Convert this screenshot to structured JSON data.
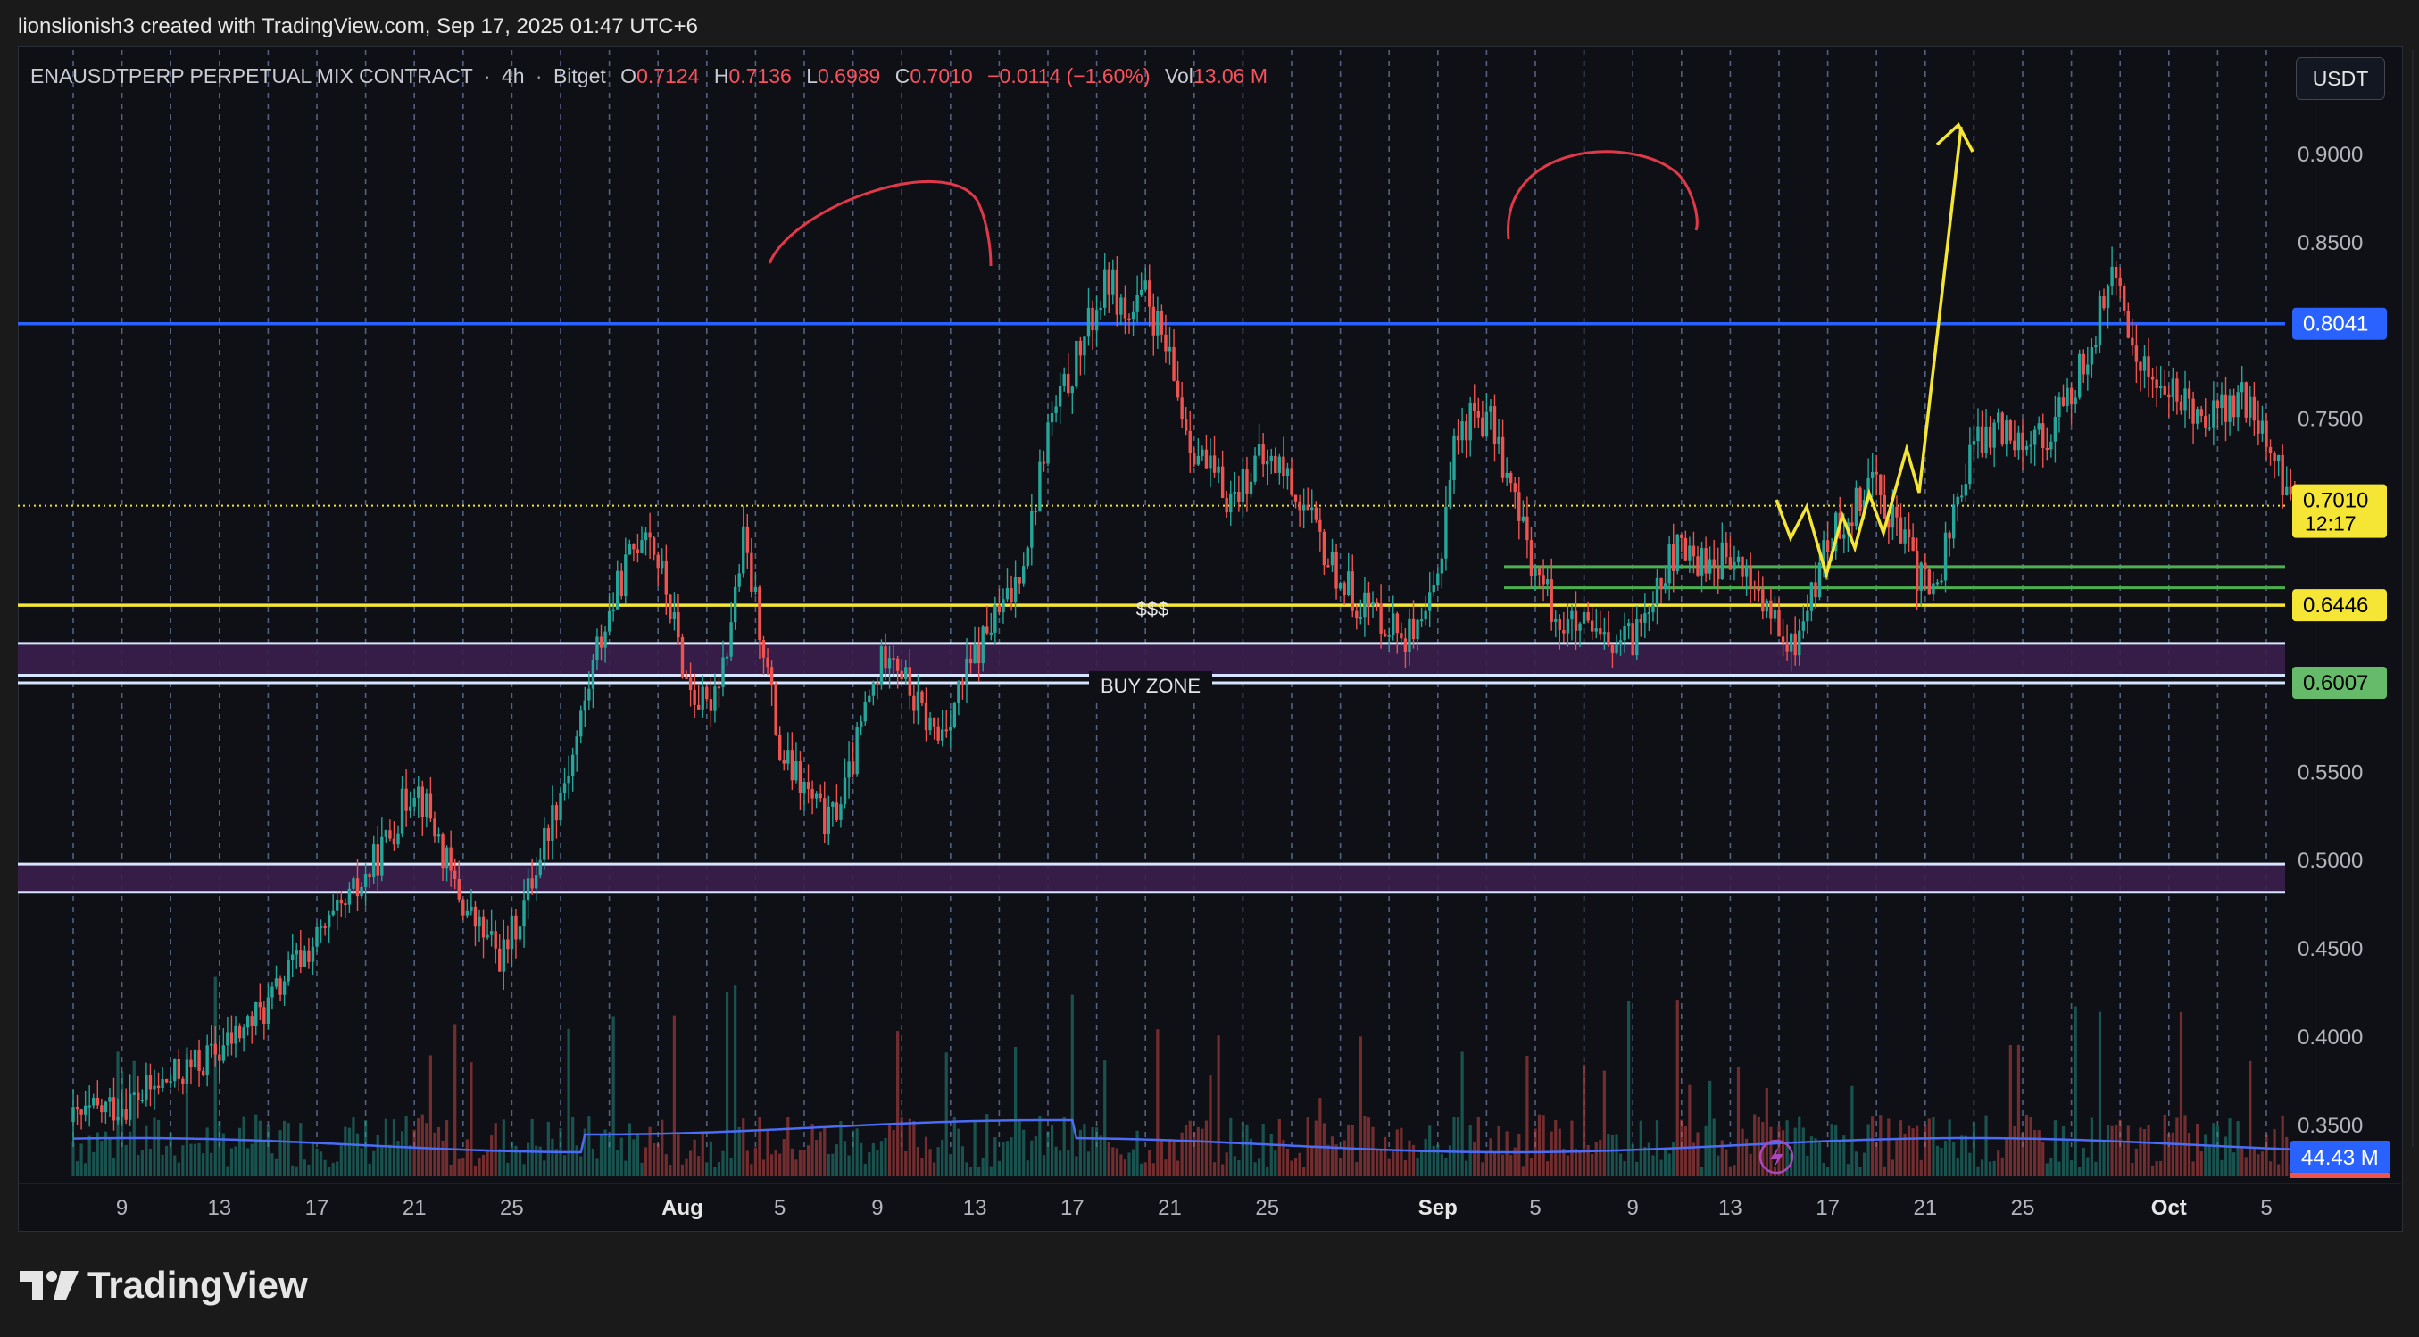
{
  "attribution": "lionslionish3 created with TradingView.com, Sep 17, 2025 01:47 UTC+6",
  "legend": {
    "symbol": "ENAUSDTPERP PERPETUAL MIX CONTRACT",
    "interval": "4h",
    "exchange": "Bitget",
    "o_label": "O",
    "o": "0.7124",
    "h_label": "H",
    "h": "0.7136",
    "l_label": "L",
    "l": "0.6989",
    "c_label": "C",
    "c": "0.7010",
    "change": "−0.0114 (−1.60%)",
    "vol_label": "Vol",
    "vol": "13.06 M"
  },
  "currency_button": "USDT",
  "brand": "TradingView",
  "colors": {
    "background": "#0f1015",
    "up_candle": "#26a69a",
    "down_candle": "#ef5350",
    "resistance_line": "#2962ff",
    "support_line": "#f5e635",
    "zone_fill": "#3a1f4d",
    "zone_border": "#d6e4ff",
    "green_line": "#4caf50",
    "projection": "#f5e635",
    "arc": "#e0394a",
    "volume_ma": "#4a6cf7",
    "grid_dashed": "#8aa4d6"
  },
  "chart_data": {
    "type": "candlestick",
    "title": "ENAUSDTPERP PERPETUAL MIX CONTRACT",
    "ylim": [
      0.33,
      0.92
    ],
    "y_ticks": [
      "0.9000",
      "0.8500",
      "0.7500",
      "0.5500",
      "0.5000",
      "0.4500",
      "0.4000",
      "0.3500"
    ],
    "x_ticks": [
      "9",
      "13",
      "17",
      "21",
      "25",
      "Aug",
      "5",
      "9",
      "13",
      "17",
      "21",
      "25",
      "Sep",
      "5",
      "9",
      "13",
      "17",
      "21",
      "25",
      "Oct",
      "5"
    ],
    "x_tick_days": [
      9,
      13,
      17,
      21,
      25,
      32,
      36,
      40,
      44,
      48,
      52,
      56,
      63,
      67,
      71,
      75,
      79,
      83,
      87,
      93,
      97
    ],
    "price_path": [
      [
        7.0,
        0.352
      ],
      [
        8.0,
        0.358
      ],
      [
        9.5,
        0.365
      ],
      [
        10.5,
        0.372
      ],
      [
        12.0,
        0.384
      ],
      [
        13.0,
        0.392
      ],
      [
        14.0,
        0.405
      ],
      [
        15.0,
        0.418
      ],
      [
        16.0,
        0.44
      ],
      [
        17.0,
        0.455
      ],
      [
        18.0,
        0.47
      ],
      [
        19.0,
        0.49
      ],
      [
        20.0,
        0.515
      ],
      [
        21.0,
        0.545
      ],
      [
        21.8,
        0.52
      ],
      [
        22.5,
        0.49
      ],
      [
        23.2,
        0.47
      ],
      [
        24.0,
        0.455
      ],
      [
        24.6,
        0.445
      ],
      [
        25.5,
        0.475
      ],
      [
        26.5,
        0.52
      ],
      [
        27.5,
        0.56
      ],
      [
        28.5,
        0.62
      ],
      [
        29.5,
        0.66
      ],
      [
        30.5,
        0.693
      ],
      [
        31.3,
        0.655
      ],
      [
        32.2,
        0.6
      ],
      [
        33.0,
        0.585
      ],
      [
        33.8,
        0.62
      ],
      [
        34.5,
        0.68
      ],
      [
        35.3,
        0.625
      ],
      [
        36.0,
        0.56
      ],
      [
        37.0,
        0.54
      ],
      [
        38.0,
        0.52
      ],
      [
        38.8,
        0.545
      ],
      [
        39.5,
        0.585
      ],
      [
        40.5,
        0.625
      ],
      [
        41.5,
        0.59
      ],
      [
        42.5,
        0.57
      ],
      [
        43.5,
        0.6
      ],
      [
        44.5,
        0.63
      ],
      [
        45.5,
        0.65
      ],
      [
        46.3,
        0.69
      ],
      [
        47.0,
        0.745
      ],
      [
        47.8,
        0.77
      ],
      [
        48.6,
        0.8
      ],
      [
        49.5,
        0.83
      ],
      [
        50.3,
        0.805
      ],
      [
        51.0,
        0.82
      ],
      [
        51.8,
        0.79
      ],
      [
        52.8,
        0.74
      ],
      [
        53.6,
        0.72
      ],
      [
        54.5,
        0.705
      ],
      [
        55.5,
        0.725
      ],
      [
        56.5,
        0.725
      ],
      [
        57.5,
        0.7
      ],
      [
        58.5,
        0.67
      ],
      [
        59.5,
        0.65
      ],
      [
        60.5,
        0.64
      ],
      [
        61.5,
        0.63
      ],
      [
        62.3,
        0.625
      ],
      [
        63.0,
        0.66
      ],
      [
        63.6,
        0.735
      ],
      [
        64.5,
        0.755
      ],
      [
        65.3,
        0.745
      ],
      [
        66.2,
        0.7
      ],
      [
        67.0,
        0.665
      ],
      [
        68.0,
        0.635
      ],
      [
        69.0,
        0.63
      ],
      [
        70.0,
        0.62
      ],
      [
        71.0,
        0.625
      ],
      [
        71.8,
        0.655
      ],
      [
        72.8,
        0.675
      ],
      [
        73.8,
        0.67
      ],
      [
        74.8,
        0.67
      ],
      [
        75.8,
        0.66
      ],
      [
        76.6,
        0.64
      ],
      [
        77.4,
        0.615
      ],
      [
        78.2,
        0.645
      ],
      [
        79.0,
        0.68
      ],
      [
        80.0,
        0.7
      ],
      [
        80.8,
        0.72
      ],
      [
        81.8,
        0.69
      ],
      [
        82.6,
        0.665
      ],
      [
        83.4,
        0.65
      ],
      [
        84.2,
        0.7
      ],
      [
        85.0,
        0.735
      ],
      [
        86.0,
        0.745
      ],
      [
        87.0,
        0.742
      ],
      [
        88.0,
        0.74
      ],
      [
        89.0,
        0.765
      ],
      [
        90.0,
        0.8
      ],
      [
        90.6,
        0.835
      ],
      [
        91.3,
        0.8
      ],
      [
        92.0,
        0.78
      ],
      [
        92.8,
        0.765
      ],
      [
        93.6,
        0.76
      ],
      [
        94.4,
        0.755
      ],
      [
        95.2,
        0.755
      ],
      [
        96.0,
        0.76
      ],
      [
        96.8,
        0.745
      ],
      [
        97.6,
        0.715
      ],
      [
        98.2,
        0.7
      ]
    ],
    "horizontal_levels": [
      {
        "price": 0.8041,
        "label": "0.8041",
        "style": "resistance"
      },
      {
        "price": 0.6446,
        "label": "0.6446",
        "style": "support"
      },
      {
        "price": 0.6007,
        "label": "0.6007",
        "style": "buy_zone"
      }
    ],
    "current_price": {
      "label": "0.7010",
      "countdown": "12:17"
    },
    "zones": [
      {
        "top": 0.623,
        "bottom": 0.605,
        "label": "BUY ZONE"
      },
      {
        "top": 0.498,
        "bottom": 0.482
      }
    ],
    "annotations": [
      "$$$",
      "BUY ZONE"
    ],
    "volume_label": "44.43 M"
  }
}
